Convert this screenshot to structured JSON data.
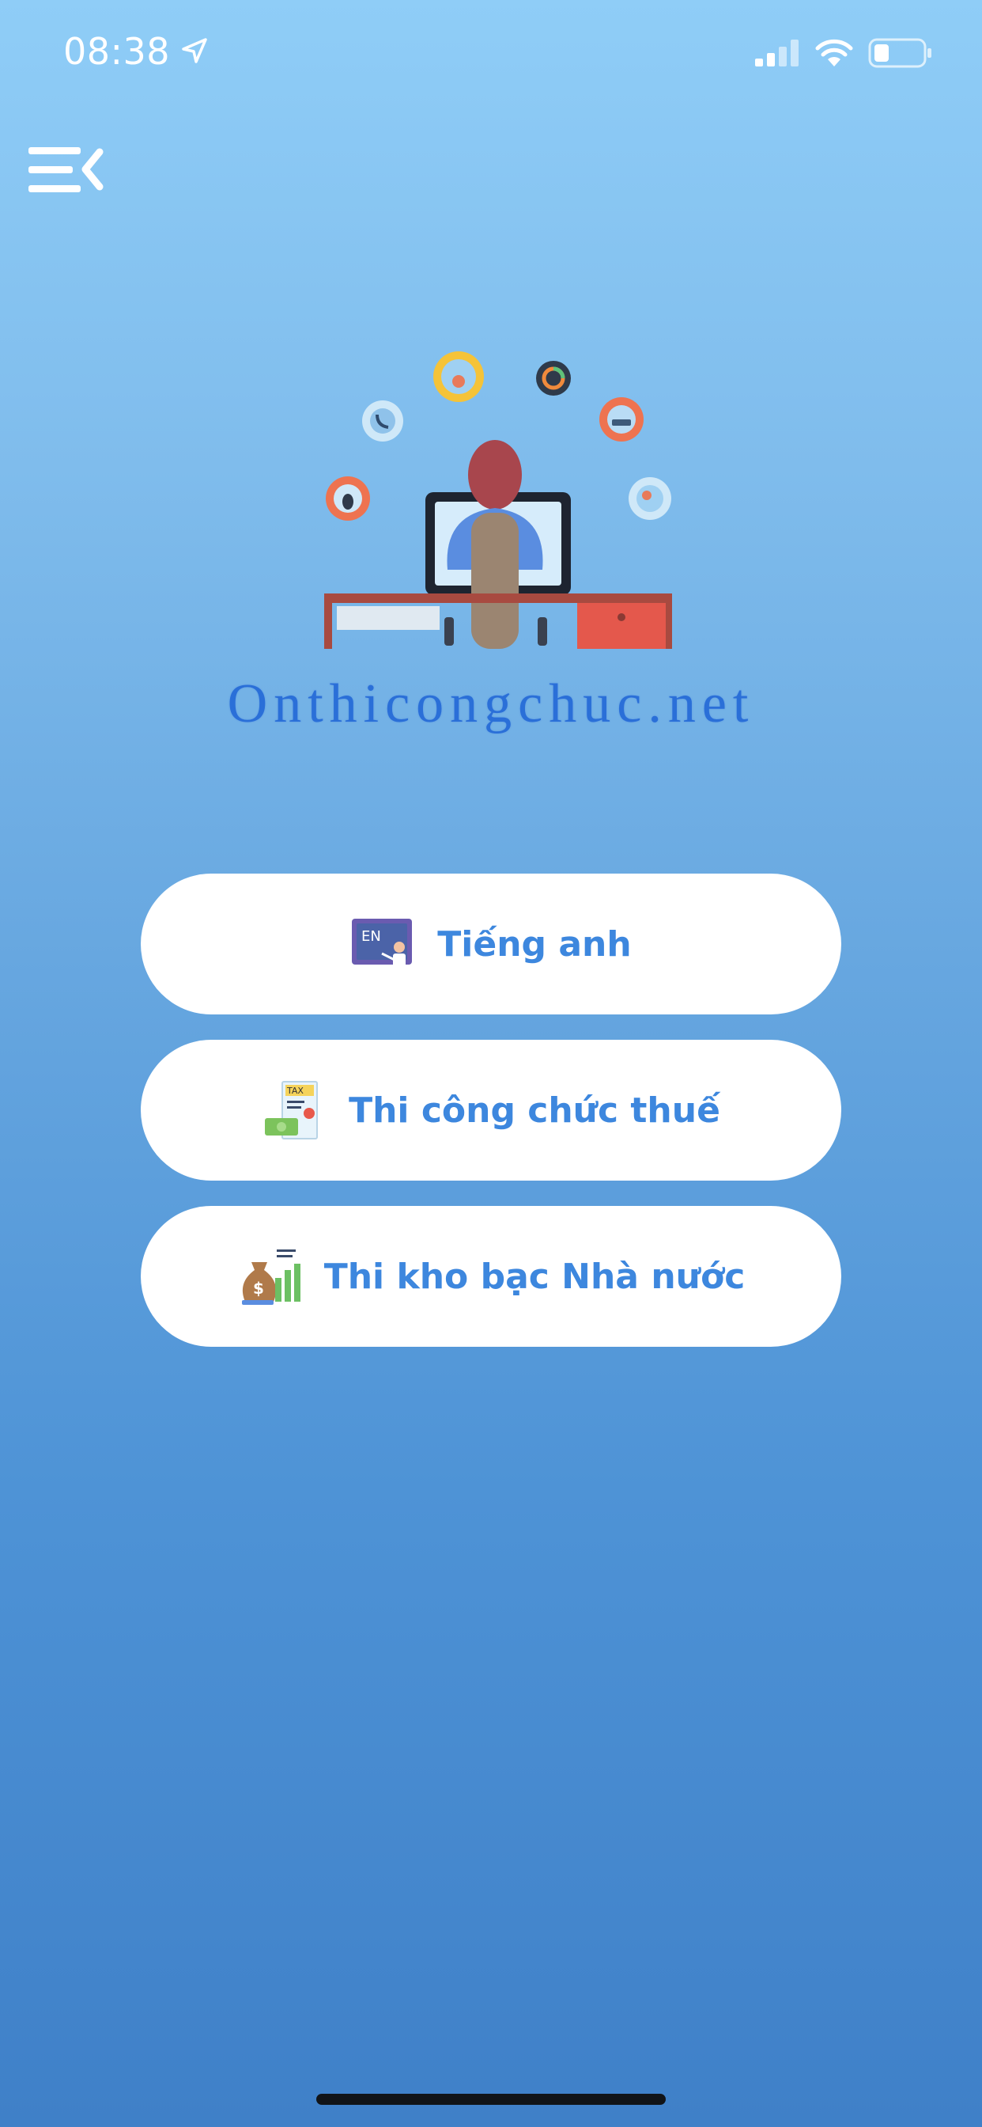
{
  "status_bar": {
    "time": "08:38",
    "icons": [
      "location-arrow-icon",
      "signal-icon",
      "wifi-icon",
      "battery-icon"
    ]
  },
  "header": {
    "menu_icon": "menu-collapse-icon"
  },
  "logo": {
    "site_name": "Onthicongchuc.net",
    "illustration": "person-at-computer-illustration"
  },
  "menu": {
    "items": [
      {
        "label": "Tiếng anh",
        "icon": "english-board-icon"
      },
      {
        "label": "Thi công chức thuế",
        "icon": "tax-document-icon"
      },
      {
        "label": "Thi kho bạc Nhà nước",
        "icon": "money-bag-chart-icon"
      }
    ]
  },
  "colors": {
    "gradient_top": "#8fcdf7",
    "gradient_bottom": "#3f80c8",
    "button_text": "#3d87de",
    "title": "#2a6fd8",
    "button_bg": "#ffffff"
  }
}
